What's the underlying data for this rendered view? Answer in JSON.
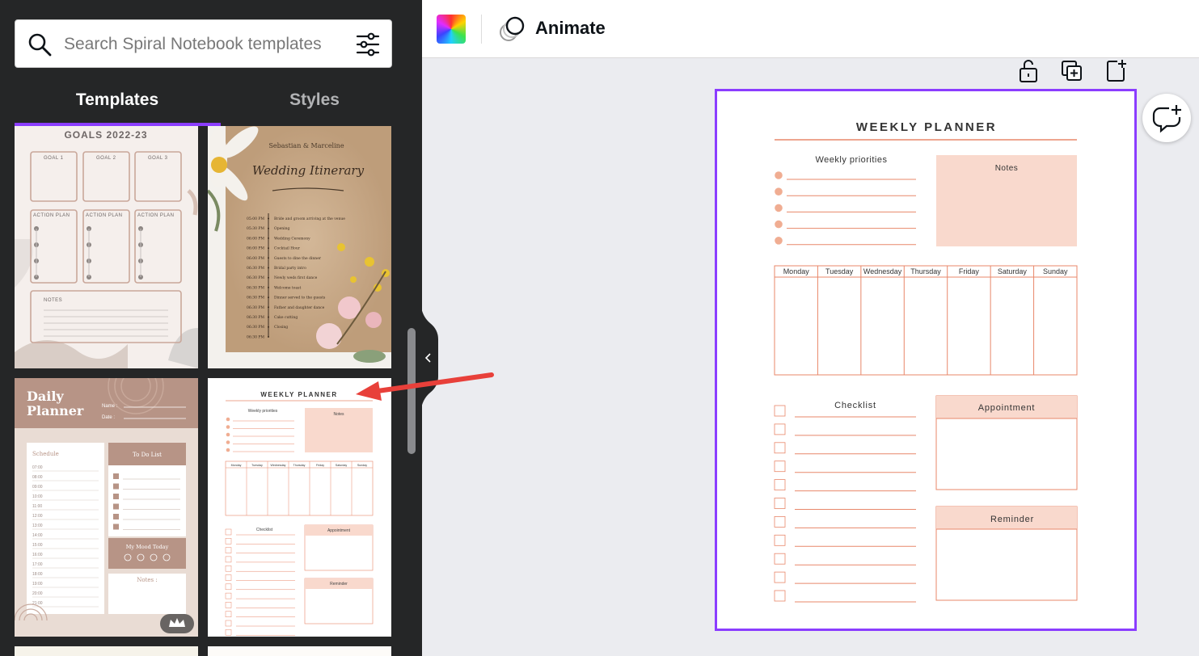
{
  "search": {
    "placeholder": "Search Spiral Notebook templates"
  },
  "tabs": [
    {
      "label": "Templates"
    },
    {
      "label": "Styles"
    }
  ],
  "toolbar": {
    "animate_label": "Animate"
  },
  "thumbs": {
    "goals": {
      "title": "GOALS 2022-23",
      "goal_labels": [
        "GOAL 1",
        "GOAL 2",
        "GOAL 3"
      ],
      "plan_label": "ACTION PLAN",
      "notes_label": "NOTES"
    },
    "wedding": {
      "names": "Sebastian & Marceline",
      "title": "Wedding Itinerary",
      "times": [
        "05:00 PM",
        "05:30 PM",
        "06:00 PM",
        "06:00 PM",
        "06:00 PM",
        "06:30 PM",
        "06:30 PM",
        "06:30 PM",
        "06:30 PM",
        "06:30 PM",
        "06:30 PM",
        "06:30 PM",
        "06:30 PM"
      ],
      "events": [
        "Bride and groom arriving at the venue",
        "Opening",
        "Wedding Ceremony",
        "Cocktail Hour",
        "Guests to dine the dinner",
        "Bridal party intro",
        "Newly weds first dance",
        "Welcome toast",
        "Dinner served to the guests",
        "Father and daughter dance",
        "Cake cutting",
        "Closing",
        ""
      ]
    },
    "daily": {
      "title1": "Daily",
      "title2": "Planner",
      "name_label": "Name :",
      "date_label": "Date :",
      "schedule": "Schedule",
      "times": [
        "07:00",
        "08:00",
        "09:00",
        "10:00",
        "11:00",
        "12:00",
        "13:00",
        "14:00",
        "15:00",
        "16:00",
        "17:00",
        "18:00",
        "19:00",
        "20:00",
        "21:00"
      ],
      "todo": "To Do List",
      "mood": "My Mood Today",
      "notes": "Notes :"
    },
    "weekly": {
      "title": "WEEKLY PLANNER",
      "priorities": "Weekly priorities",
      "notes": "Notes",
      "days": [
        "Monday",
        "Tuesday",
        "Wednesday",
        "Thursday",
        "Friday",
        "Saturday",
        "Sunday"
      ],
      "checklist": "Checklist",
      "appointment": "Appointment",
      "reminder": "Reminder"
    }
  },
  "planner": {
    "title": "WEEKLY PLANNER",
    "priorities_label": "Weekly priorities",
    "notes_label": "Notes",
    "days": [
      "Monday",
      "Tuesday",
      "Wednesday",
      "Thursday",
      "Friday",
      "Saturday",
      "Sunday"
    ],
    "checklist_label": "Checklist",
    "appointment_label": "Appointment",
    "reminder_label": "Reminder"
  },
  "colors": {
    "accent": "#8b3dff",
    "peach": "#f9d9cd",
    "salmon_line": "#e8876a",
    "bullet": "#f0ad92",
    "panel_bg": "#252627",
    "annotation_arrow": "#e8403a"
  },
  "icons": {
    "search": "search-icon",
    "filter": "sliders-icon",
    "color": "color-palette-icon",
    "animate": "animate-icon",
    "lock": "unlock-icon",
    "duplicate": "duplicate-page-icon",
    "add_page": "add-page-icon",
    "comment": "add-comment-icon",
    "collapse": "chevron-left-icon",
    "premium": "crown-icon"
  }
}
